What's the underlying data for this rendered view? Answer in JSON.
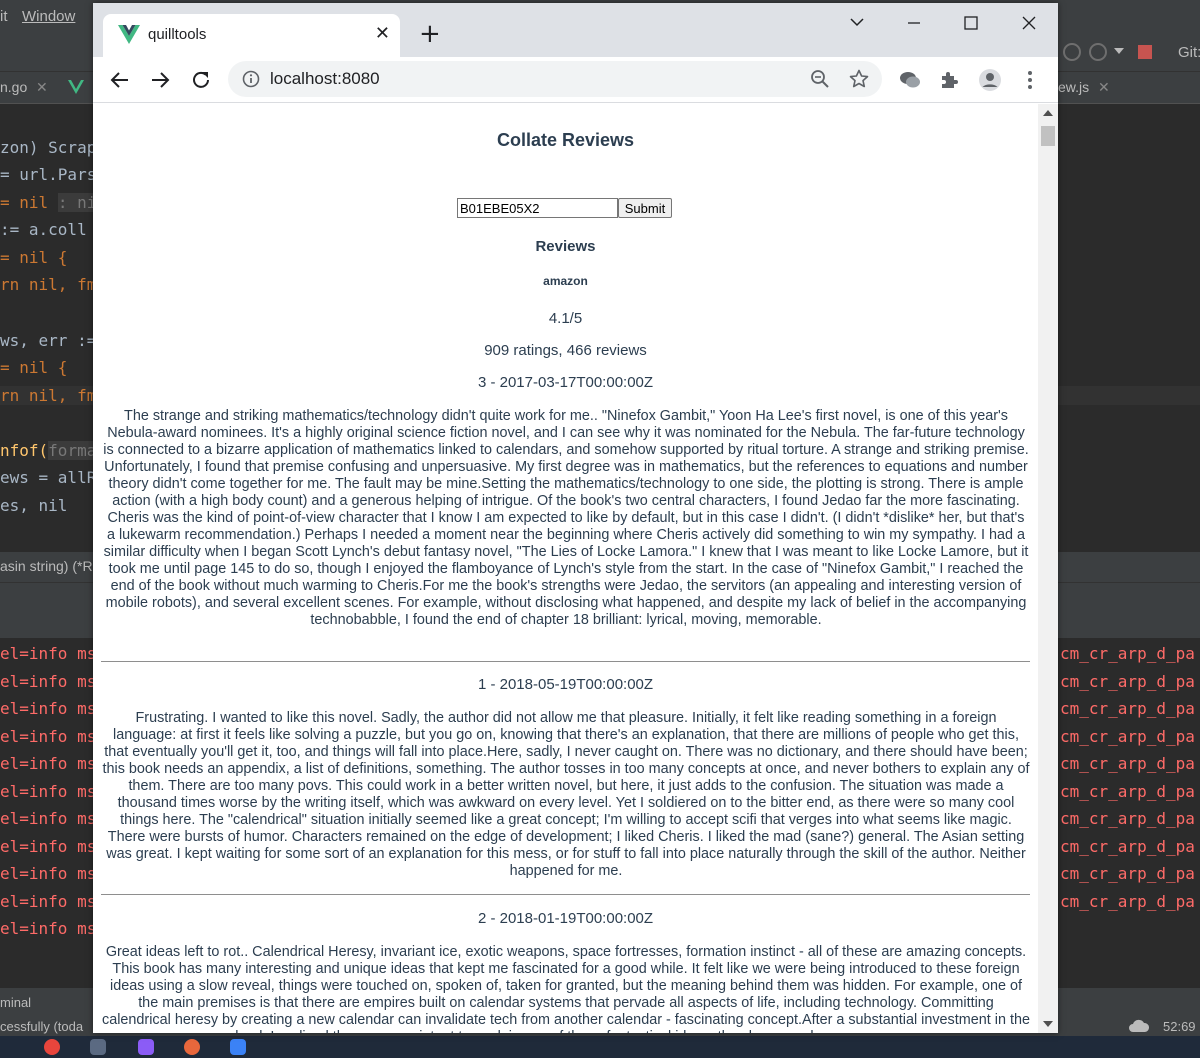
{
  "ide": {
    "menu": [
      "it",
      "Window"
    ],
    "tabs": {
      "left_file": "n.go",
      "right_file": "ew.js"
    },
    "git_label": "Git:",
    "code": {
      "l1": "zon) Scrap",
      "l2_a": "= url.Pars",
      "l3_a": "= nil",
      "l3_hint": ": ni",
      "l4_a": ":= a.coll",
      "l5_a": "= nil {",
      "l6_a": "rn nil, fm",
      "l7_a": "ws, err :=",
      "l8_a": "= nil {",
      "l9_a": "rn nil, fm",
      "l10_a": "nfof(",
      "l10_hint": "forma",
      "l11_a": "ews = allR",
      "l12_a": "es, nil"
    },
    "crumb": "asin string) (*R",
    "log_left": "el=info ms",
    "log_right": "cm_cr_arp_d_pa",
    "status_left_1": "minal",
    "status_left_2": "cessfully (toda",
    "clock": "52:69"
  },
  "browser": {
    "tab_title": "quilltools",
    "tab_close": "✕",
    "new_tab": "+",
    "url": "localhost:8080",
    "colors": {
      "vue_green": "#41b883",
      "vue_dark": "#34495e",
      "text": "#2c3e50"
    }
  },
  "page": {
    "title": "Collate Reviews",
    "asin_value": "B01EBE05X2",
    "submit_label": "Submit",
    "reviews_heading": "Reviews",
    "source": "amazon",
    "rating": "4.1/5",
    "counts": "909 ratings, 466 reviews",
    "reviews": [
      {
        "header": "3 - 2017-03-17T00:00:00Z",
        "text": "The strange and striking mathematics/technology didn't quite work for me.. \"Ninefox Gambit,\" Yoon Ha Lee's first novel, is one of this year's Nebula-award nominees. It's a highly original science fiction novel, and I can see why it was nominated for the Nebula. The far-future technology is connected to a bizarre application of mathematics linked to calendars, and somehow supported by ritual torture. A strange and striking premise. Unfortunately, I found that premise confusing and unpersuasive. My first degree was in mathematics, but the references to equations and number theory didn't come together for me. The fault may be mine.Setting the mathematics/technology to one side, the plotting is strong. There is ample action (with a high body count) and a generous helping of intrigue. Of the book's two central characters, I found Jedao far the more fascinating. Cheris was the kind of point-of-view character that I know I am expected to like by default, but in this case I didn't. (I didn't *dislike* her, but that's a lukewarm recommendation.) Perhaps I needed a moment near the beginning where Cheris actively did something to win my sympathy. I had a similar difficulty when I began Scott Lynch's debut fantasy novel, \"The Lies of Locke Lamora.\" I knew that I was meant to like Locke Lamore, but it took me until page 145 to do so, though I enjoyed the flamboyance of Lynch's style from the start. In the case of \"Ninefox Gambit,\" I reached the end of the book without much warming to Cheris.For me the book's strengths were Jedao, the servitors (an appealing and interesting version of mobile robots), and several excellent scenes. For example, without disclosing what happened, and despite my lack of belief in the accompanying technobabble, I found the end of chapter 18 brilliant: lyrical, moving, memorable."
      },
      {
        "header": "1 - 2018-05-19T00:00:00Z",
        "text": "Frustrating. I wanted to like this novel. Sadly, the author did not allow me that pleasure. Initially, it felt like reading something in a foreign language: at first it feels like solving a puzzle, but you go on, knowing that there's an explanation, that there are millions of people who get this, that eventually you'll get it, too, and things will fall into place.Here, sadly, I never caught on. There was no dictionary, and there should have been; this book needs an appendix, a list of definitions, something. The author tosses in too many concepts at once, and never bothers to explain any of them. There are too many povs. This could work in a better written novel, but here, it just adds to the confusion. The situation was made a thousand times worse by the writing itself, which was awkward on every level. Yet I soldiered on to the bitter end, as there were so many cool things here. The \"calendrical\" situation initially seemed like a great concept; I'm willing to accept scifi that verges into what seems like magic. There were bursts of humor. Characters remained on the edge of development; I liked Cheris. I liked the mad (sane?) general. The Asian setting was great. I kept waiting for some sort of an explanation for this mess, or for stuff to fall into place naturally through the skill of the author. Neither happened for me."
      },
      {
        "header": "2 - 2018-01-19T00:00:00Z",
        "text": "Great ideas left to rot.. Calendrical Heresy, invariant ice, exotic weapons, space fortresses, formation instinct - all of these are amazing concepts. This book has many interesting and unique ideas that kept me fascinated for a good while. It felt like we were being introduced to these foreign ideas using a slow reveal, things were touched on, spoken of, taken for granted, but the meaning behind them was hidden. For example, one of the main premises is that there are empires built on calendar systems that pervade all aspects of life, including technology. Committing calendrical heresy by creating a new calendar can invalidate tech from another calendar - fascinating concept.After a substantial investment in the book I realized there was no intent to explain any of these fantastical ideas, the slow reveal was my own"
      }
    ]
  }
}
